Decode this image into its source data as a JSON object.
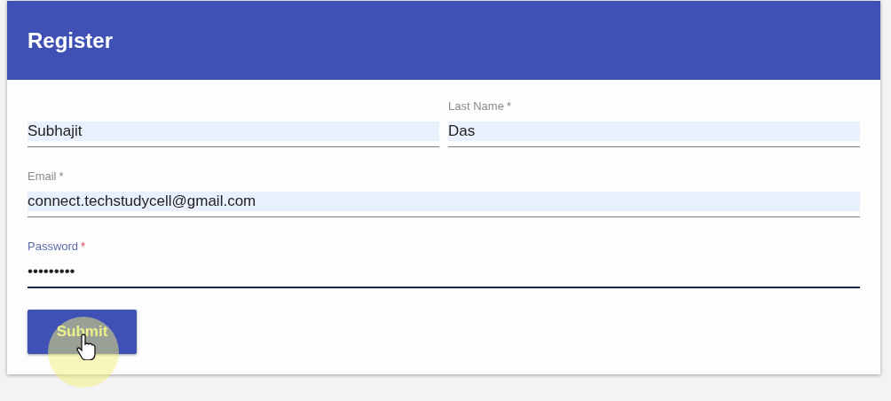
{
  "header": {
    "title": "Register"
  },
  "rows": [
    [
      {
        "value": "Subhajit",
        "autofilled": true,
        "focused": false
      },
      {
        "label": "Last Name",
        "mark": "*",
        "value": "Das",
        "autofilled": true,
        "focused": false
      }
    ],
    [
      {
        "label": "Email",
        "mark": "*",
        "value": "connect.techstudycell@gmail.com",
        "autofilled": true,
        "focused": false
      }
    ],
    [
      {
        "label": "Password",
        "mark": "*",
        "value": "•••••••••",
        "autofilled": false,
        "focused": true
      }
    ]
  ],
  "submit": {
    "label": "Submit"
  }
}
